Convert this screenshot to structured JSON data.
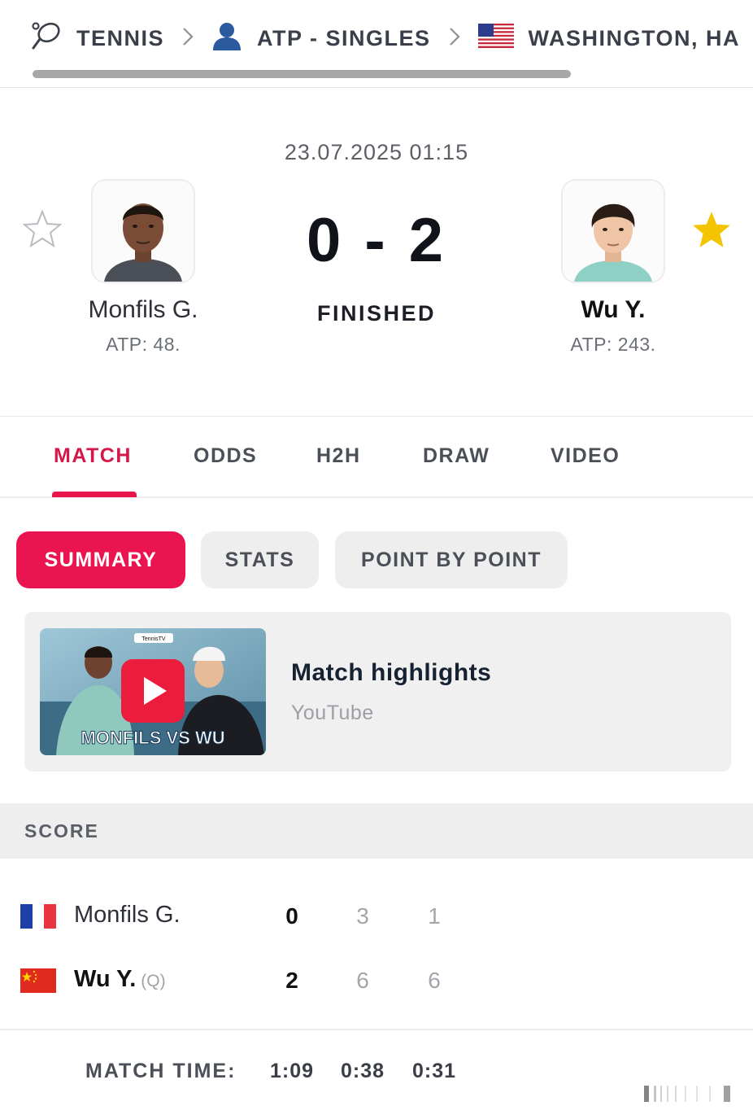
{
  "breadcrumb": {
    "sport": "TENNIS",
    "category": "ATP - SINGLES",
    "tournament": "WASHINGTON, HA"
  },
  "match": {
    "datetime": "23.07.2025 01:15",
    "score": "0 - 2",
    "status": "FINISHED",
    "home": {
      "name": "Monfils G.",
      "rank": "ATP: 48.",
      "favorite": false
    },
    "away": {
      "name": "Wu Y.",
      "rank": "ATP: 243.",
      "favorite": true
    }
  },
  "tabs": [
    "MATCH",
    "ODDS",
    "H2H",
    "DRAW",
    "VIDEO"
  ],
  "active_tab": "MATCH",
  "subtabs": [
    "SUMMARY",
    "STATS",
    "POINT BY POINT"
  ],
  "active_subtab": "SUMMARY",
  "video": {
    "title": "Match highlights",
    "source": "YouTube",
    "thumb_text": "MONFILS VS WU",
    "thumb_badge": "TennisTV"
  },
  "score_section": {
    "header": "SCORE",
    "rows": [
      {
        "name": "Monfils G.",
        "qualifier": "",
        "country": "France",
        "sets": "0",
        "set1": "3",
        "set2": "1",
        "winner": false
      },
      {
        "name": "Wu Y.",
        "qualifier": "(Q)",
        "country": "China",
        "sets": "2",
        "set1": "6",
        "set2": "6",
        "winner": true
      }
    ],
    "match_time_label": "MATCH TIME:",
    "match_time": [
      "1:09",
      "0:38",
      "0:31"
    ]
  },
  "colors": {
    "accent": "#EA1451",
    "star_active": "#F5C400",
    "tab_active": "#D5184A"
  },
  "icons": [
    "tennis-racket-icon",
    "chevron-right-icon",
    "player-person-icon",
    "usa-flag-icon",
    "star-outline-icon",
    "star-filled-icon",
    "play-icon",
    "france-flag-icon",
    "china-flag-icon"
  ]
}
